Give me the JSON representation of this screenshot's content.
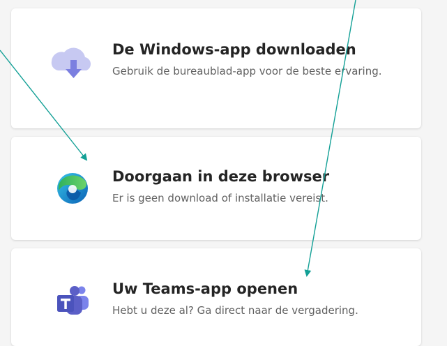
{
  "options": [
    {
      "icon": "cloud-download-icon",
      "title": "De Windows-app downloaden",
      "description": "Gebruik de bureaublad-app voor de beste ervaring."
    },
    {
      "icon": "edge-browser-icon",
      "title": "Doorgaan in deze browser",
      "description": "Er is geen download of installatie vereist."
    },
    {
      "icon": "teams-logo-icon",
      "title": "Uw Teams-app openen",
      "description": "Hebt u deze al? Ga direct naar de vergadering."
    }
  ],
  "colors": {
    "accent_purple": "#5b5fc7",
    "light_purple": "#c7c9f2",
    "annotation": "#13a096"
  }
}
